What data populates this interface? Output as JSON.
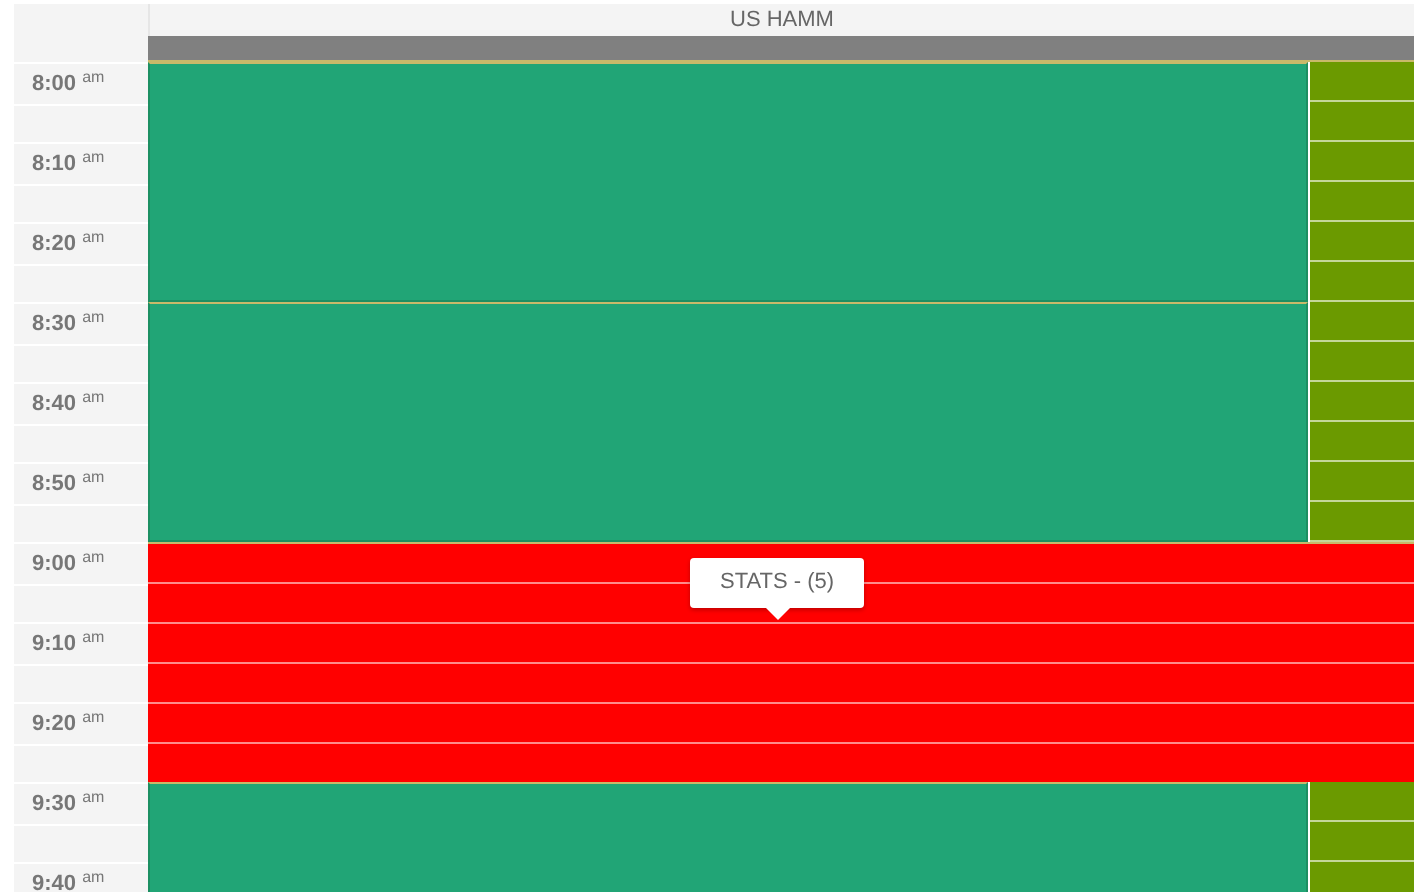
{
  "calendar": {
    "resource": "US HAMM",
    "times": [
      "8:00 $^{am}$",
      "8:10 $^{am}$",
      "8:20 $^{am}$",
      "8:30 $^{am}$",
      "8:40 $^{am}$",
      "8:50 $^{am}$",
      "9:00 $^{am}$",
      "9:10 $^{am}$",
      "9:20 $^{am}$",
      "9:30 $^{am}$",
      "9:40 $^{am}$"
    ],
    "blocks": [
      {
        "kind": "appointment"
      },
      {
        "kind": "appointment"
      },
      {
        "kind": "unavailable",
        "tooltip": "STATS - (5)"
      },
      {
        "kind": "appointment"
      }
    ]
  }
}
